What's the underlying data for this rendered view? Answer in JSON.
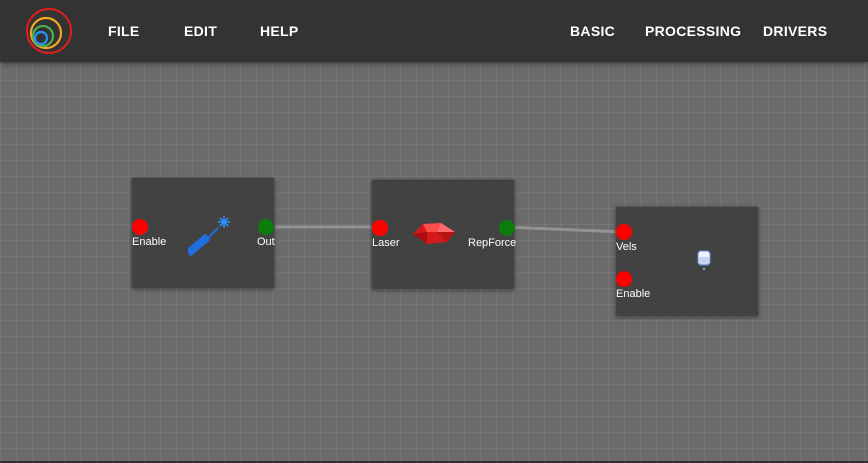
{
  "menu": {
    "file": "FILE",
    "edit": "EDIT",
    "help": "HELP"
  },
  "categories": {
    "basic": "BASIC",
    "processing": "PROCESSING",
    "drivers": "DRIVERS"
  },
  "icons": {
    "logo": "concentric-rings-logo-icon",
    "node1": "laser-pointer-icon",
    "node2": "red-gem-icon",
    "node3": "usb-drive-icon"
  },
  "colors": {
    "topbar": "#333333",
    "canvas": "#6b6b6b",
    "node": "#424242",
    "port_input": "#ff0000",
    "port_output": "#0b7d0b",
    "edge": "#9a9a9a"
  },
  "nodes": {
    "laser_source": {
      "input_label": "Enable",
      "output_label": "Out"
    },
    "laser_effect": {
      "input_label": "Laser",
      "output_label": "RepForce"
    },
    "driver": {
      "input1_label": "Vels",
      "input2_label": "Enable"
    }
  }
}
